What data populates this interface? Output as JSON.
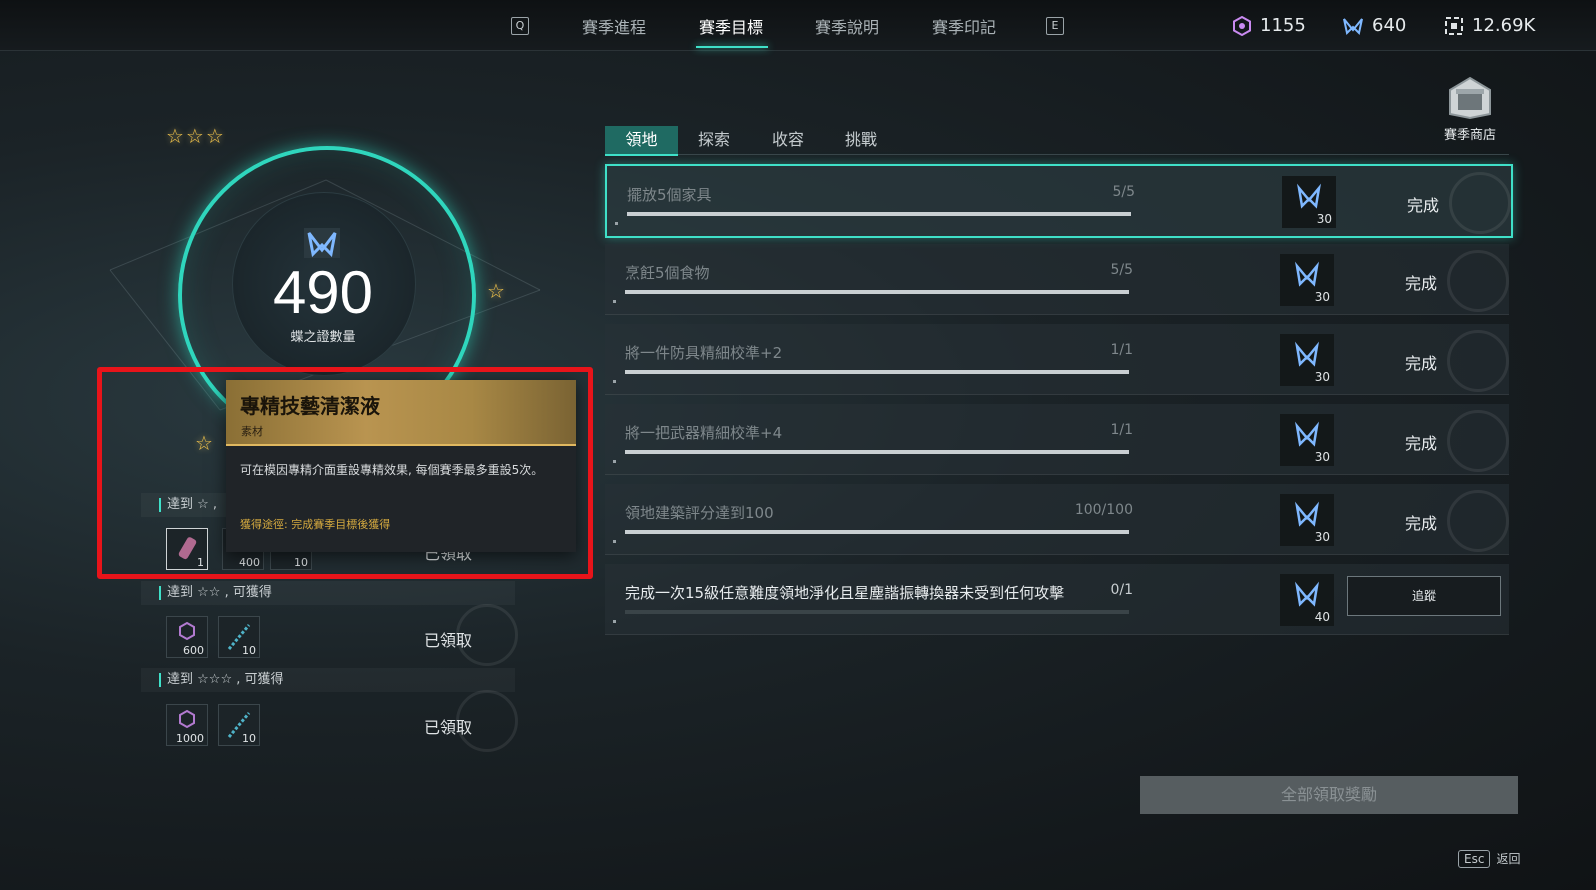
{
  "top_nav": {
    "key_left": "Q",
    "key_right": "E",
    "tabs": [
      "賽季進程",
      "賽季目標",
      "賽季說明",
      "賽季印記"
    ],
    "active_tab": "賽季目標"
  },
  "currencies": [
    {
      "icon": "hex-token-icon",
      "value": "1155"
    },
    {
      "icon": "butterfly-icon",
      "value": "640"
    },
    {
      "icon": "frame-icon",
      "value": "12.69K"
    }
  ],
  "shop": {
    "label": "賽季商店"
  },
  "emblem": {
    "count": "490",
    "label": "蝶之證數量",
    "stars_top": "☆☆☆",
    "star_right": "☆",
    "star_left": "☆"
  },
  "rewards": [
    {
      "header": "達到 ☆ ,",
      "items": [
        {
          "icon": "potion-icon",
          "qty": "1"
        },
        {
          "icon": "hex-token-icon",
          "qty": "400"
        },
        {
          "icon": "feather-icon",
          "qty": "10"
        }
      ],
      "status": "已領取"
    },
    {
      "header": "達到 ☆☆ , 可獲得",
      "items": [
        {
          "icon": "hex-token-icon",
          "qty": "600"
        },
        {
          "icon": "feather-icon",
          "qty": "10"
        }
      ],
      "status": "已領取"
    },
    {
      "header": "達到 ☆☆☆ , 可獲得",
      "items": [
        {
          "icon": "hex-token-icon",
          "qty": "1000"
        },
        {
          "icon": "feather-icon",
          "qty": "10"
        }
      ],
      "status": "已領取"
    }
  ],
  "tooltip": {
    "title": "專精技藝清潔液",
    "subtitle": "素材",
    "description": "可在模因專精介面重設專精效果, 每個賽季最多重設5次。",
    "source": "獲得途徑: 完成賽季目標後獲得"
  },
  "category_tabs": [
    "領地",
    "探索",
    "收容",
    "挑戰"
  ],
  "active_category": "領地",
  "tasks": [
    {
      "name": "擺放5個家具",
      "progress": "5/5",
      "fill": 1.0,
      "reward": "30",
      "status": "完成"
    },
    {
      "name": "烹飪5個食物",
      "progress": "5/5",
      "fill": 1.0,
      "reward": "30",
      "status": "完成"
    },
    {
      "name": "將一件防具精細校準+2",
      "progress": "1/1",
      "fill": 1.0,
      "reward": "30",
      "status": "完成"
    },
    {
      "name": "將一把武器精細校準+4",
      "progress": "1/1",
      "fill": 1.0,
      "reward": "30",
      "status": "完成"
    },
    {
      "name": "領地建築評分達到100",
      "progress": "100/100",
      "fill": 1.0,
      "reward": "30",
      "status": "完成"
    },
    {
      "name": "完成一次15級任意難度領地淨化且星塵諧振轉換器未受到任何攻擊",
      "progress": "0/1",
      "fill": 0.0,
      "reward": "40",
      "action": "追蹤"
    }
  ],
  "claim_all": "全部領取獎勵",
  "footer": {
    "key": "Esc",
    "label": "返回"
  }
}
